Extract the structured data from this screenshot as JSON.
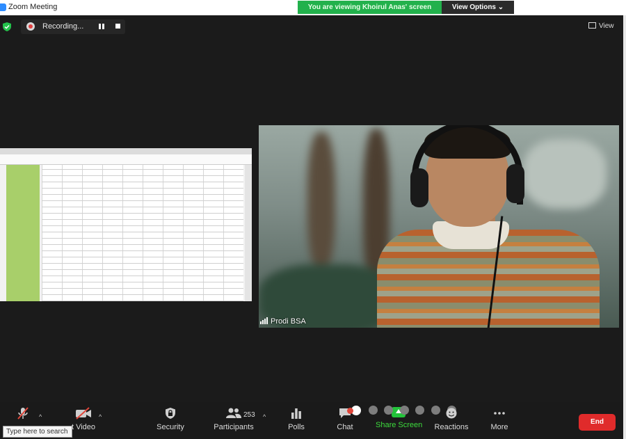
{
  "window": {
    "title": "Zoom Meeting"
  },
  "banner": {
    "viewing_text": "You are viewing Khoirul Anas' screen",
    "view_options_label": "View Options ⌄"
  },
  "recording": {
    "label": "Recording..."
  },
  "view_button": {
    "label": "View"
  },
  "participant_video": {
    "name": "Prodi BSA"
  },
  "toolbar": {
    "video_label": "t Video",
    "security_label": "Security",
    "participants_label": "Participants",
    "participants_count": "253",
    "polls_label": "Polls",
    "chat_label": "Chat",
    "share_label": "Share Screen",
    "reactions_label": "Reactions",
    "more_label": "More",
    "end_label": "End",
    "caret": "^"
  },
  "taskbar": {
    "search_placeholder": "Type here to search"
  },
  "colors": {
    "share_green": "#22c33a",
    "banner_green": "#22b14c",
    "end_red": "#e02b2b",
    "stage_bg": "#1b1b1b"
  }
}
